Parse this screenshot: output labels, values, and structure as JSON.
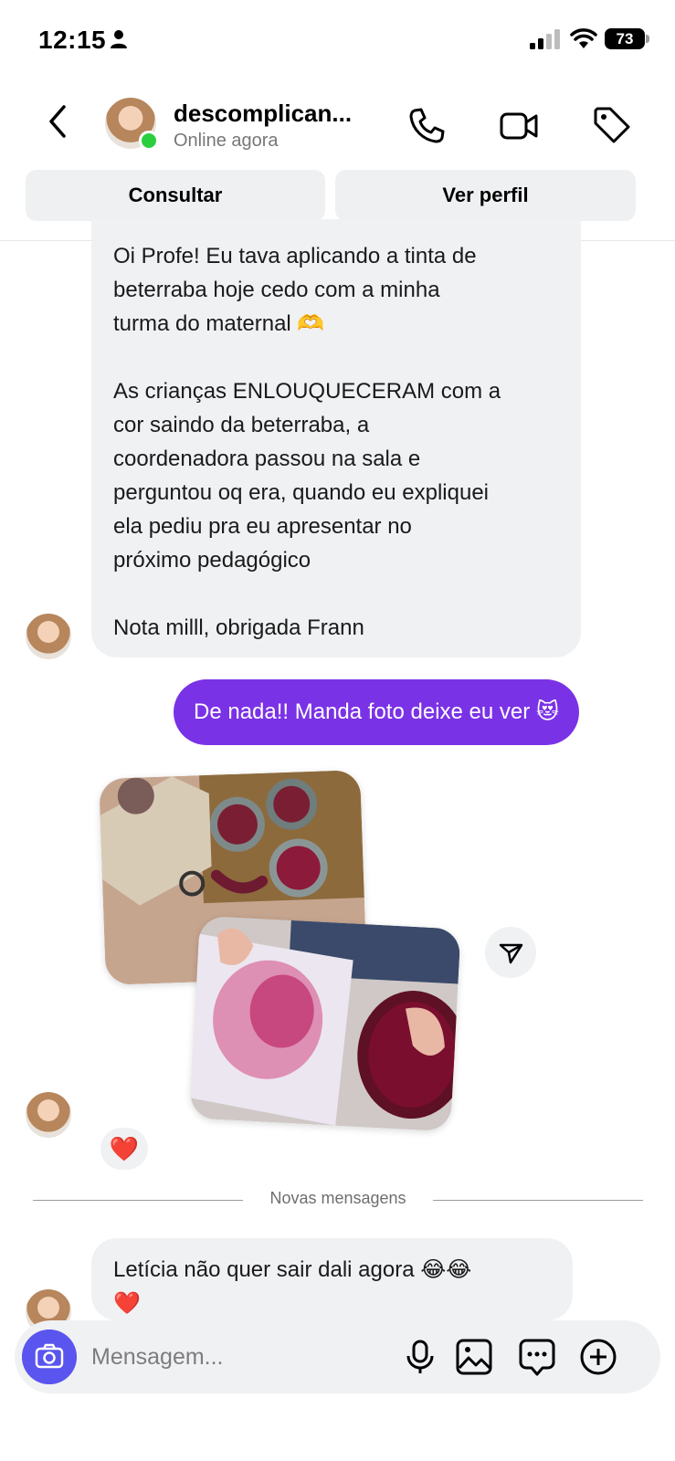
{
  "status_bar": {
    "time": "12:15",
    "battery": "73"
  },
  "header": {
    "contact_name": "descomplican...",
    "contact_status": "Online agora",
    "buttons": {
      "consult": "Consultar",
      "view_profile": "Ver perfil"
    }
  },
  "messages": [
    {
      "from": "contact",
      "paragraphs": [
        [
          "Oi Profe! Eu tava aplicando a tinta de",
          "beterraba hoje cedo com a minha",
          "turma do maternal 🫶"
        ],
        [
          "As crianças ENLOUQUECERAM com a",
          "cor saindo da beterraba, a",
          "coordenadora passou na sala e",
          "perguntou oq era, quando eu expliquei",
          "ela pediu pra eu apresentar no",
          "próximo pedagógico"
        ],
        [
          "Nota milll, obrigada Frann"
        ]
      ]
    },
    {
      "from": "me",
      "text": "De nada!! Manda foto deixe eu ver 😻"
    },
    {
      "from": "contact",
      "type": "photos",
      "count": 2,
      "reaction": "❤️"
    },
    {
      "from": "contact",
      "lines": [
        "Letícia não quer sair dali agora 😂😂",
        "❤️"
      ]
    }
  ],
  "separator": "Novas mensagens",
  "composer": {
    "placeholder": "Mensagem..."
  },
  "colors": {
    "accent": "#7a32e6",
    "camera": "#5a55ee",
    "online": "#2bcf3d",
    "bubble_in": "#f0f1f3"
  },
  "icons": [
    "person-icon",
    "signal-icon",
    "wifi-icon",
    "back-icon",
    "phone-icon",
    "video-icon",
    "tag-icon",
    "share-icon",
    "camera-icon",
    "mic-icon",
    "gallery-icon",
    "sticker-icon",
    "plus-icon"
  ]
}
